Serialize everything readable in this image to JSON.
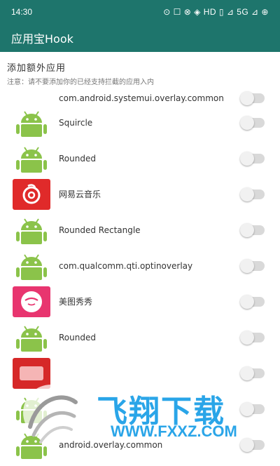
{
  "status_bar": {
    "time": "14:30",
    "indicators": "⊙ ☐ ⊗ ◈ HD ▯ ⊿ 5G ⊿ ⊕"
  },
  "app_bar": {
    "title": "应用宝Hook"
  },
  "section": {
    "title": "添加额外应用",
    "hint": "注意：请不要添加你的已经支持拦截的应用入内"
  },
  "apps": [
    {
      "label": "com.android.systemui.overlay.common",
      "icon": "android-icon",
      "enabled": false,
      "partial": true
    },
    {
      "label": "Squircle",
      "icon": "android-icon",
      "enabled": false
    },
    {
      "label": "Rounded",
      "icon": "android-icon",
      "enabled": false
    },
    {
      "label": "网易云音乐",
      "icon": "netease-music-icon",
      "enabled": false
    },
    {
      "label": "Rounded Rectangle",
      "icon": "android-icon",
      "enabled": false
    },
    {
      "label": "com.qualcomm.qti.optinoverlay",
      "icon": "android-icon",
      "enabled": false
    },
    {
      "label": "美图秀秀",
      "icon": "meitu-icon",
      "enabled": false
    },
    {
      "label": "Rounded",
      "icon": "android-icon",
      "enabled": false
    },
    {
      "label": "",
      "icon": "red-app-icon",
      "enabled": false
    },
    {
      "label": "",
      "icon": "android-icon",
      "enabled": false
    },
    {
      "label": "android.overlay.common",
      "icon": "android-icon",
      "enabled": false
    }
  ],
  "watermark": {
    "title": "飞翔下载",
    "url": "WWW.FXXZ.COM"
  },
  "colors": {
    "primary": "#1e756c",
    "toggle_off": "#d9d9d9",
    "watermark": "#2aa5e8"
  }
}
